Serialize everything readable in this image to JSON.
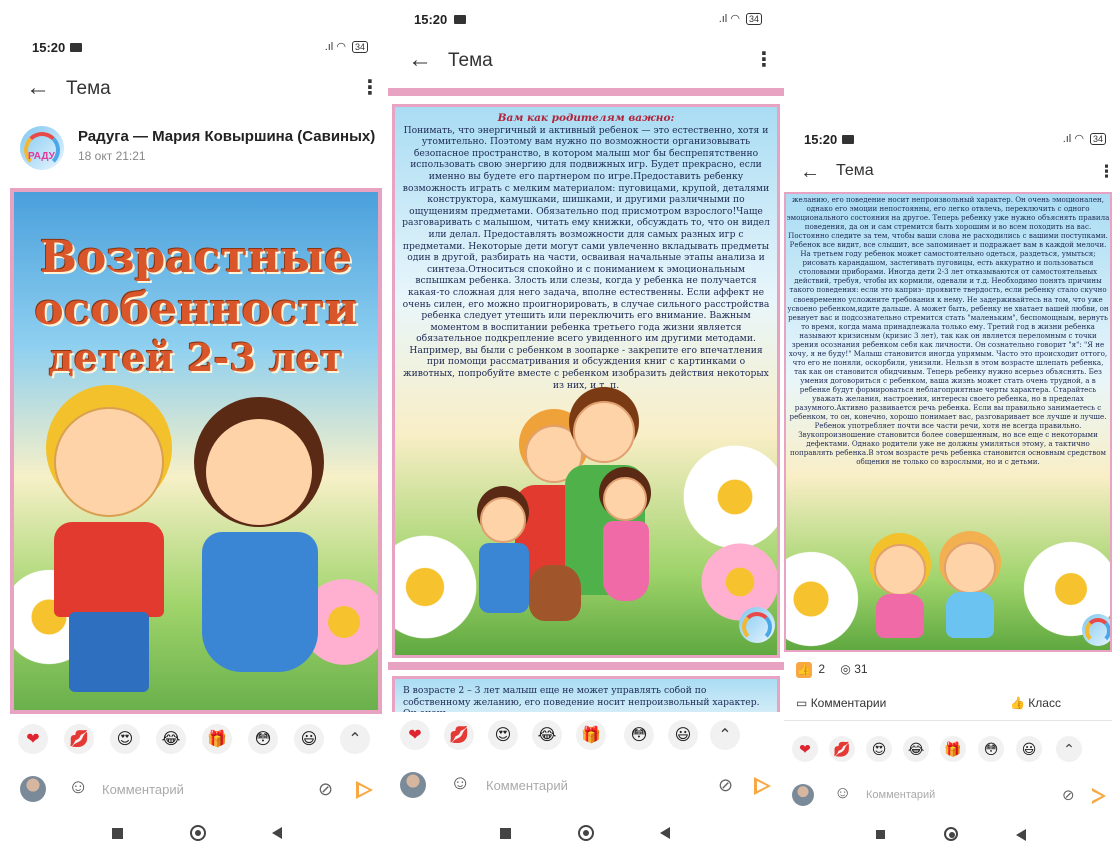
{
  "status": {
    "time": "15:20",
    "battery": "34",
    "signal": "signal-icon",
    "wifi": "wifi-icon"
  },
  "topic": {
    "title": "Тема"
  },
  "author": {
    "name": "Радуга — Мария Ковыршина (Савиных)",
    "date": "18 окт 21:21",
    "logo_text": "РАДУ"
  },
  "post": {
    "cover_title_lines": [
      "Возрастные",
      "особенности",
      "детей 2-3 лет"
    ],
    "page2_heading": "Вам как родителям важно:",
    "page2_text": "Понимать, что энергичный и активный ребенок — это естественно, хотя и утомительно. Поэтому вам нужно по возможности организовывать безопасное пространство, в котором малыш мог бы беспрепятственно использовать свою энергию для подвижных игр. Будет прекрасно, если именно вы будете его партнером по игре.Предоставить ребенку возможность играть с мелким материалом: пуговицами, крупой, деталями конструктора, камушками, шишками, и другими различными по ощущениям предметами. Обязательно под присмотром взрослого!Чаще разговаривать с малышом, читать ему книжки, обсуждать то, что он видел или делал. Предоставлять возможности для самых разных игр с предметами. Некоторые дети могут сами увлеченно вкладывать предметы один в другой, разбирать на части, осваивая начальные этапы анализа и синтеза.Относиться спокойно и с пониманием к эмоциональным вспышкам ребенка. Злость или слезы, когда у ребенка не получается какая-то сложная для него задача, вполне естественны. Если аффект не очень силен, его можно проигнорировать, в случае сильного расстройства ребенка следует утешить или переключить его внимание. Важным моментом в воспитании ребенка третьего года жизни является обязательное подкрепление всего увиденного им другими методами. Например, вы были с ребенком в зоопарке - закрепите его впечатления при помощи рассматривания и обсуждения книг с картинками о животных, попробуйте вместе с ребенком изобразить действия некоторых из них, и т. п.",
    "page3_intro": "В возрасте 2 – 3 лет малыш еще не может управлять собой по собственному желанию, его поведение носит непроизвольный характер. Он очень",
    "page3_text": "желанию, его поведение носит непроизвольный характер. Он очень эмоционален, однако его эмоции непостоянны, его легко отвлечь, переключить с одного эмоционального состояния на другое. Теперь ребенку уже нужно объяснять правила поведения, да он и сам стремится быть хорошим и во всем походить на вас. Постоянно следите за тем, чтобы ваши слова не расходились с вашими поступками. Ребенок все видит, все слышит, все запоминает и подражает вам в каждой мелочи. На третьем году ребенок может самостоятельно одеться, раздеться, умыться; рисовать карандашом, застегивать пуговицы, есть аккуратно и пользоваться столовыми приборами. Иногда дети 2-3 лет отказываются от самостоятельных действий, требуя, чтобы их кормили, одевали и т.д. Необходимо понять причины такого поведения: если это каприз- проявите твердость, если ребенку стало скучно своевременно усложните требования к нему. Не задерживайтесь на том, что уже усвоено ребенком,идите дальше. А может быть, ребенку не хватает вашей любви, он ревнует вас и подсознательно стремится стать \"маленьким\", беспомощным, вернуть то время, когда мама принадлежала только ему. Третий год в жизни ребенка называют кризисным (кризис 3 лет), так как он является переломным с точки зрения осознания ребенком себя как личности. Он сознательно говорит \"я\": \"Я не хочу, я не буду!\" Малыш становится иногда упрямым. Часто это происходит оттого, что его не поняли, оскорбили, унизили. Нельзя в этом возрасте шлепать ребенка, так как он становится обидчивым. Теперь ребенку нужно всерьез объяснять. Без умения договориться с ребенком, ваша жизнь может стать очень трудной, а в ребенке будут формироваться неблагоприятные черты характера. Старайтесь уважать желания, настроения, интересы своего ребенка, но в пределах разумного.Активно развивается речь ребенка. Если вы правильно занимаетесь с ребенком, то он, конечно, хорошо понимает вас, разговаривает все лучше и лучше. Ребенок употребляет почти все части речи, хотя не всегда правильно. Звукопроизношение становится более совершенным, но все еще с некоторыми дефектами. Однако родители уже не должны умиляться этому, а тактично поправлять ребенка.В этом возрасте речь ребенка становится основным средством общения не только со взрослыми, но и с детьми."
  },
  "stats": {
    "likes": "2",
    "views": "31"
  },
  "actions": {
    "comments": "Комментарии",
    "klass": "Класс"
  },
  "reactions": [
    "heart-icon",
    "kiss-icon",
    "love-eyes-icon",
    "laughing-icon",
    "gift-icon",
    "surprised-icon",
    "smile-icon",
    "chevron-up-icon"
  ],
  "reaction_glyphs": [
    "❤",
    "💋",
    "😍",
    "😂",
    "🎁",
    "😳",
    "😃",
    "⌃"
  ],
  "comment": {
    "placeholder": "Комментарий"
  },
  "colors": {
    "accent": "#f7a842",
    "pink": "#e8a3c2",
    "title_orange": "#d9552a",
    "text_navy": "#1e2a55"
  }
}
